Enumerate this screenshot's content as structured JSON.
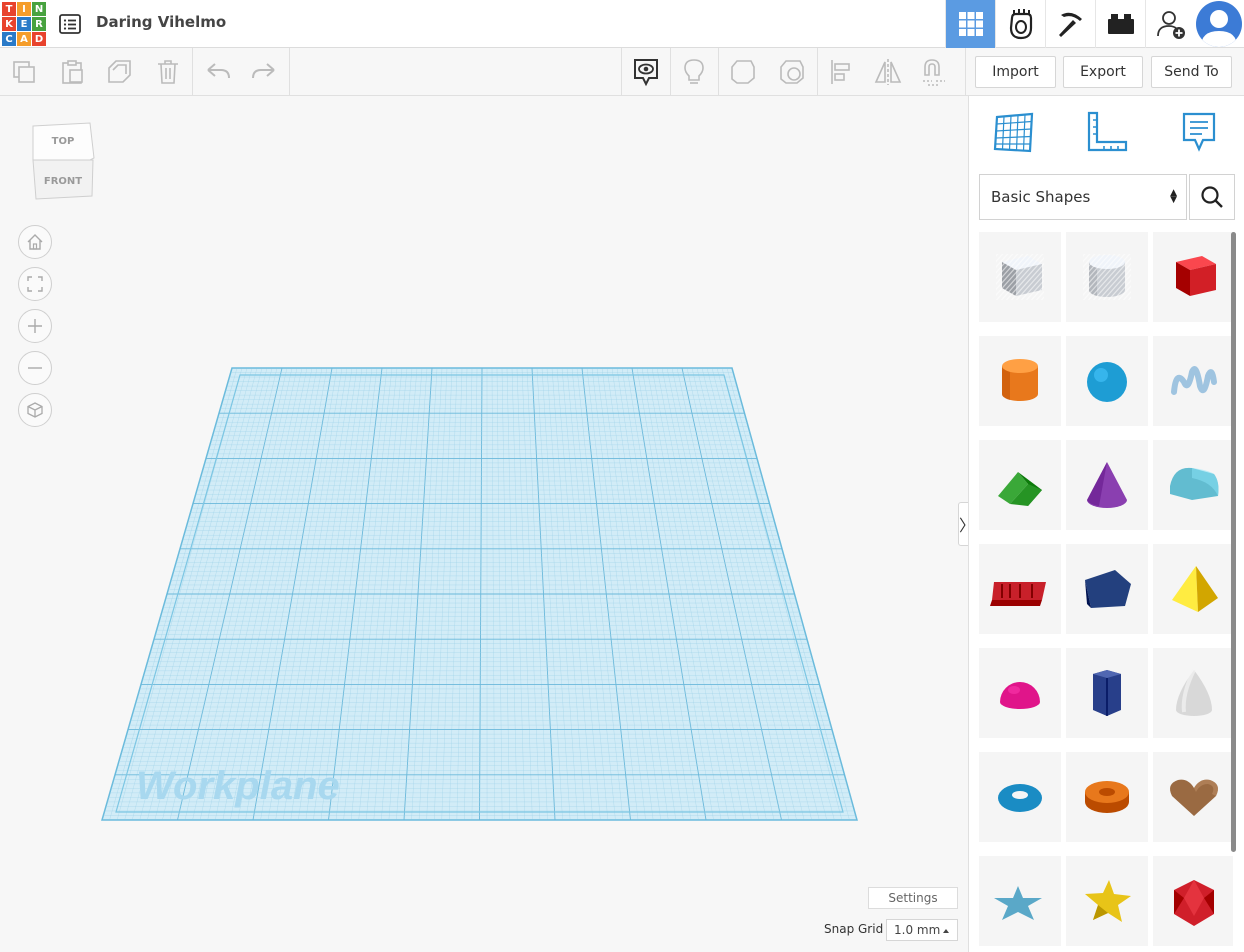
{
  "app": {
    "logo_letters": [
      "T",
      "I",
      "N",
      "K",
      "E",
      "R",
      "C",
      "A",
      "D"
    ],
    "logo_colors": [
      "#e8432d",
      "#f59d2a",
      "#48a23f",
      "#e8432d",
      "#2a7ac8",
      "#48a23f",
      "#2a7ac8",
      "#f59d2a",
      "#e8432d"
    ],
    "document_title": "Daring Vihelmo",
    "accent_color": "#5b9be2"
  },
  "topbar": {
    "icons": [
      {
        "name": "3d-design-grid-icon",
        "active": true
      },
      {
        "name": "circuits-icon",
        "active": false
      },
      {
        "name": "minecraft-pickaxe-icon",
        "active": false
      },
      {
        "name": "lego-brick-icon",
        "active": false
      },
      {
        "name": "invite-user-icon",
        "active": false
      },
      {
        "name": "user-avatar-icon",
        "active": false
      }
    ]
  },
  "toolbar": {
    "left_tools": [
      "copy-icon",
      "paste-icon",
      "duplicate-icon",
      "delete-icon",
      "undo-icon",
      "redo-icon"
    ],
    "right_tools": [
      "show-notes-icon",
      "light-bulb-icon",
      "shape-solid-icon",
      "shape-hole-icon",
      "align-icon",
      "mirror-icon",
      "cruise-magnet-icon"
    ],
    "import_label": "Import",
    "export_label": "Export",
    "send_to_label": "Send To"
  },
  "viewcube": {
    "top_label": "TOP",
    "front_label": "FRONT"
  },
  "navigation": [
    "home-view-icon",
    "fit-all-icon",
    "zoom-in-icon",
    "zoom-out-icon",
    "ortho-view-icon"
  ],
  "workplane": {
    "label": "Workplane",
    "color": "#a8d8ef"
  },
  "canvas_footer": {
    "settings_label": "Settings",
    "snap_grid_label": "Snap Grid",
    "snap_grid_value": "1.0 mm"
  },
  "panel": {
    "view_icons": [
      "workplane-grid-icon",
      "ruler-icon",
      "notes-icon"
    ],
    "category_select": "Basic Shapes",
    "collapse_symbol": "〉",
    "shapes": [
      {
        "name": "box-hole-shape",
        "color": "#c8ccd2"
      },
      {
        "name": "cylinder-hole-shape",
        "color": "#c8ccd2"
      },
      {
        "name": "box-shape",
        "color": "#d21f26"
      },
      {
        "name": "cylinder-shape",
        "color": "#e8781c"
      },
      {
        "name": "sphere-shape",
        "color": "#1e9dd4"
      },
      {
        "name": "scribble-shape",
        "color": "#9fc4e0"
      },
      {
        "name": "roof-shape",
        "color": "#3aa838"
      },
      {
        "name": "cone-shape",
        "color": "#8a3fb0"
      },
      {
        "name": "round-roof-shape",
        "color": "#62bcd0"
      },
      {
        "name": "text-shape",
        "color": "#c8202a"
      },
      {
        "name": "polygon-shape",
        "color": "#23407e"
      },
      {
        "name": "pyramid-shape",
        "color": "#f0c419"
      },
      {
        "name": "half-sphere-shape",
        "color": "#e0158a"
      },
      {
        "name": "hexagonal-prism-shape",
        "color": "#283f8a"
      },
      {
        "name": "paraboloid-shape",
        "color": "#d8d8d8"
      },
      {
        "name": "torus-shape",
        "color": "#1a8cc4"
      },
      {
        "name": "tube-shape",
        "color": "#e8781c"
      },
      {
        "name": "heart-shape",
        "color": "#9a6a42"
      },
      {
        "name": "star-shape",
        "color": "#5aa8c8"
      },
      {
        "name": "star-yellow-shape",
        "color": "#e8c418"
      },
      {
        "name": "icosahedron-shape",
        "color": "#d01f2a"
      }
    ]
  }
}
